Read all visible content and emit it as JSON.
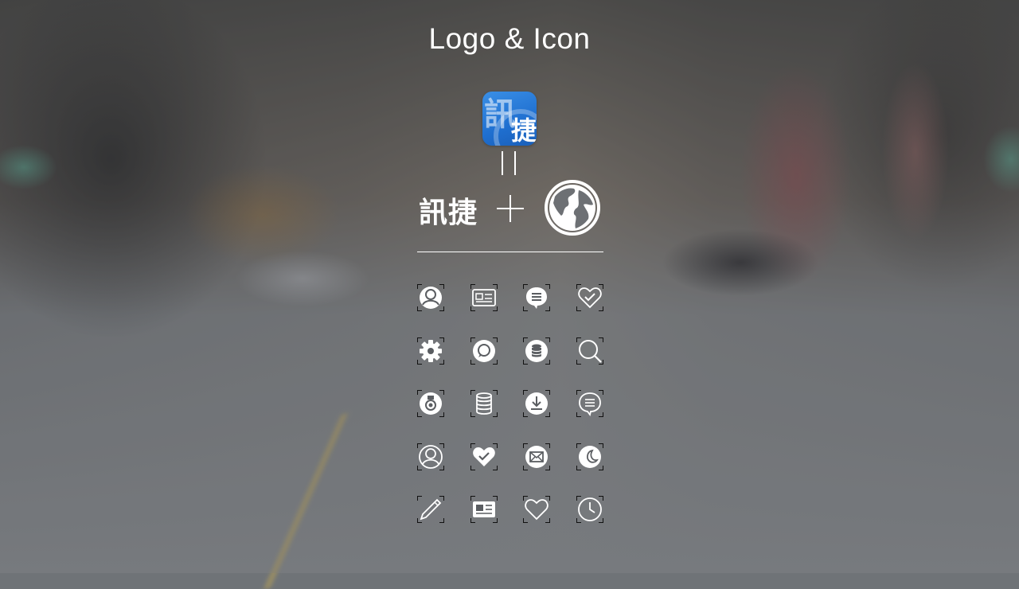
{
  "header": {
    "title": "Logo & Icon"
  },
  "logo": {
    "app_icon_chars": [
      "訊",
      "捷"
    ],
    "brand_text": "訊捷",
    "app_icon_color": "#2478d8"
  },
  "icons": [
    [
      "user-circle-icon",
      "news-outline-icon",
      "chat-bubble-filled-icon",
      "heart-check-outline-icon"
    ],
    [
      "gear-icon",
      "chat-circle-icon",
      "database-circle-icon",
      "search-icon"
    ],
    [
      "medal-icon",
      "database-icon",
      "download-circle-icon",
      "chat-bubble-outline-icon"
    ],
    [
      "user-circle-outline-icon",
      "heart-check-filled-icon",
      "mail-circle-icon",
      "moon-circle-icon"
    ],
    [
      "pencil-icon",
      "news-filled-icon",
      "heart-outline-icon",
      "clock-icon"
    ]
  ]
}
